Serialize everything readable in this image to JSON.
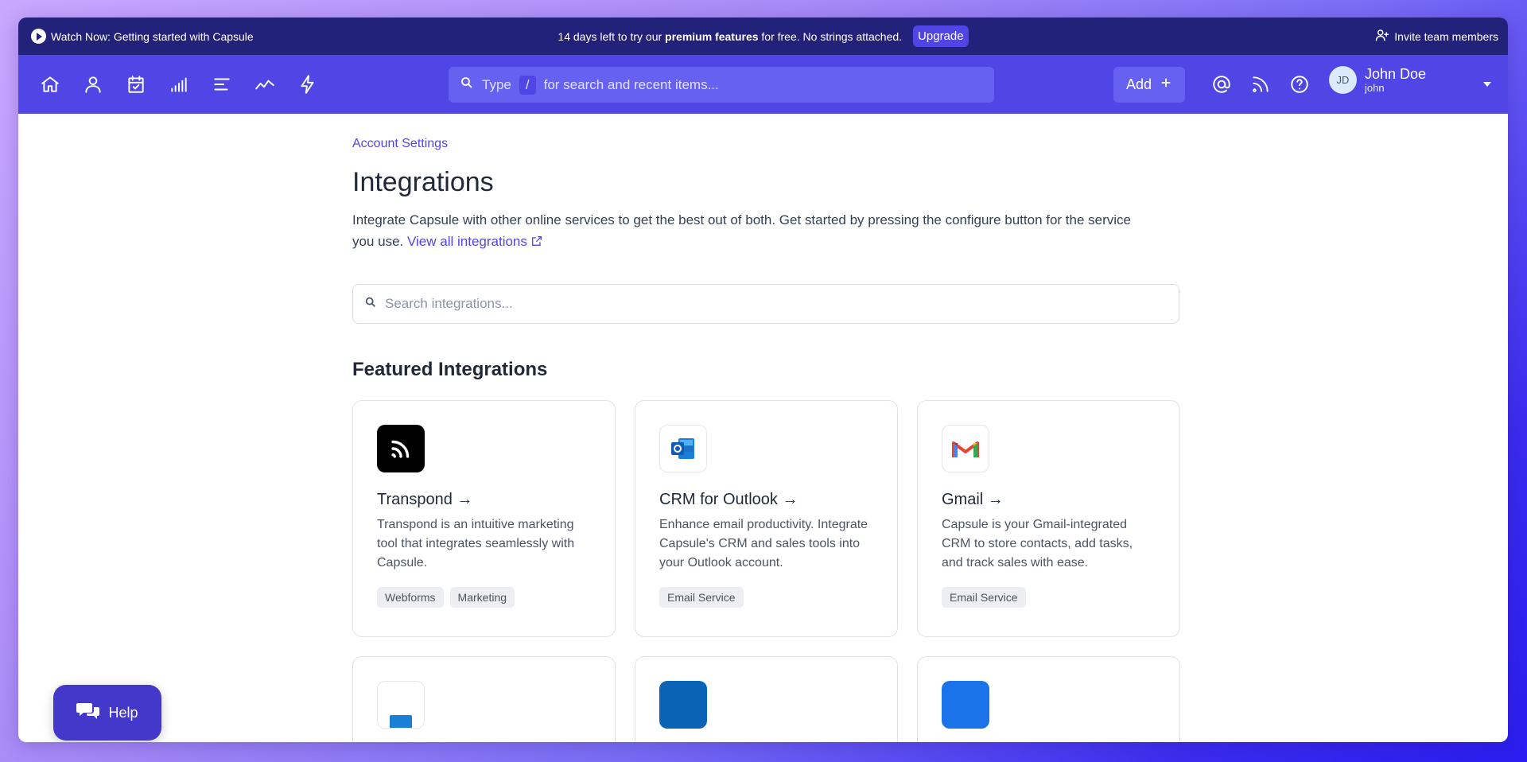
{
  "promo": {
    "watch_label": "Watch Now: Getting started with Capsule",
    "trial_prefix": "14 days left to try our",
    "trial_bold": "premium features",
    "trial_suffix": "for free. No strings attached.",
    "upgrade_label": "Upgrade",
    "invite_label": "Invite team members"
  },
  "nav": {
    "icons": [
      "home-icon",
      "person-icon",
      "calendar-check-icon",
      "bar-chart-icon",
      "list-icon",
      "trend-line-icon",
      "lightning-icon"
    ],
    "search_type": "Type",
    "search_key": "/",
    "search_placeholder": "for search and recent items...",
    "add_label": "Add",
    "util_icons": [
      "at-sign-icon",
      "rss-feed-icon",
      "help-circle-icon"
    ],
    "user": {
      "initials": "JD",
      "name": "John Doe",
      "username": "john"
    }
  },
  "main": {
    "breadcrumb": "Account Settings",
    "title": "Integrations",
    "intro_text": "Integrate Capsule with other online services to get the best out of both. Get started by pressing the configure button for the service you use.",
    "view_all_label": "View all integrations",
    "search_placeholder": "Search integrations...",
    "featured_title": "Featured Integrations",
    "cards": [
      {
        "title": "Transpond →",
        "desc": "Transpond is an intuitive marketing tool that integrates seamlessly with Capsule.",
        "tags": [
          "Webforms",
          "Marketing"
        ],
        "icon": "transpond-logo-icon"
      },
      {
        "title": "CRM for Outlook →",
        "desc": "Enhance email productivity. Integrate Capsule's CRM and sales tools into your Outlook account.",
        "tags": [
          "Email Service"
        ],
        "icon": "outlook-logo-icon"
      },
      {
        "title": "Gmail →",
        "desc": "Capsule is your Gmail-integrated CRM to store contacts, add tasks, and track sales with ease.",
        "tags": [
          "Email Service"
        ],
        "icon": "gmail-logo-icon"
      }
    ]
  },
  "help": {
    "label": "Help"
  },
  "colors": {
    "brand": "#4f46e5",
    "promo_bg": "#23227a"
  }
}
